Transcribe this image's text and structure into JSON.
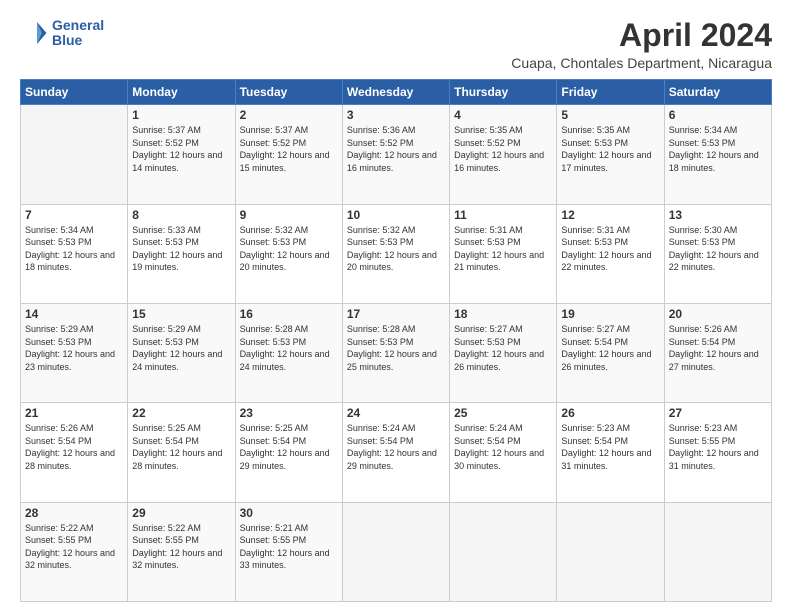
{
  "header": {
    "logo_line1": "General",
    "logo_line2": "Blue",
    "month": "April 2024",
    "location": "Cuapa, Chontales Department, Nicaragua"
  },
  "days_of_week": [
    "Sunday",
    "Monday",
    "Tuesday",
    "Wednesday",
    "Thursday",
    "Friday",
    "Saturday"
  ],
  "weeks": [
    [
      {
        "day": "",
        "sunrise": "",
        "sunset": "",
        "daylight": ""
      },
      {
        "day": "1",
        "sunrise": "5:37 AM",
        "sunset": "5:52 PM",
        "daylight": "12 hours and 14 minutes."
      },
      {
        "day": "2",
        "sunrise": "5:37 AM",
        "sunset": "5:52 PM",
        "daylight": "12 hours and 15 minutes."
      },
      {
        "day": "3",
        "sunrise": "5:36 AM",
        "sunset": "5:52 PM",
        "daylight": "12 hours and 16 minutes."
      },
      {
        "day": "4",
        "sunrise": "5:35 AM",
        "sunset": "5:52 PM",
        "daylight": "12 hours and 16 minutes."
      },
      {
        "day": "5",
        "sunrise": "5:35 AM",
        "sunset": "5:53 PM",
        "daylight": "12 hours and 17 minutes."
      },
      {
        "day": "6",
        "sunrise": "5:34 AM",
        "sunset": "5:53 PM",
        "daylight": "12 hours and 18 minutes."
      }
    ],
    [
      {
        "day": "7",
        "sunrise": "5:34 AM",
        "sunset": "5:53 PM",
        "daylight": "12 hours and 18 minutes."
      },
      {
        "day": "8",
        "sunrise": "5:33 AM",
        "sunset": "5:53 PM",
        "daylight": "12 hours and 19 minutes."
      },
      {
        "day": "9",
        "sunrise": "5:32 AM",
        "sunset": "5:53 PM",
        "daylight": "12 hours and 20 minutes."
      },
      {
        "day": "10",
        "sunrise": "5:32 AM",
        "sunset": "5:53 PM",
        "daylight": "12 hours and 20 minutes."
      },
      {
        "day": "11",
        "sunrise": "5:31 AM",
        "sunset": "5:53 PM",
        "daylight": "12 hours and 21 minutes."
      },
      {
        "day": "12",
        "sunrise": "5:31 AM",
        "sunset": "5:53 PM",
        "daylight": "12 hours and 22 minutes."
      },
      {
        "day": "13",
        "sunrise": "5:30 AM",
        "sunset": "5:53 PM",
        "daylight": "12 hours and 22 minutes."
      }
    ],
    [
      {
        "day": "14",
        "sunrise": "5:29 AM",
        "sunset": "5:53 PM",
        "daylight": "12 hours and 23 minutes."
      },
      {
        "day": "15",
        "sunrise": "5:29 AM",
        "sunset": "5:53 PM",
        "daylight": "12 hours and 24 minutes."
      },
      {
        "day": "16",
        "sunrise": "5:28 AM",
        "sunset": "5:53 PM",
        "daylight": "12 hours and 24 minutes."
      },
      {
        "day": "17",
        "sunrise": "5:28 AM",
        "sunset": "5:53 PM",
        "daylight": "12 hours and 25 minutes."
      },
      {
        "day": "18",
        "sunrise": "5:27 AM",
        "sunset": "5:53 PM",
        "daylight": "12 hours and 26 minutes."
      },
      {
        "day": "19",
        "sunrise": "5:27 AM",
        "sunset": "5:54 PM",
        "daylight": "12 hours and 26 minutes."
      },
      {
        "day": "20",
        "sunrise": "5:26 AM",
        "sunset": "5:54 PM",
        "daylight": "12 hours and 27 minutes."
      }
    ],
    [
      {
        "day": "21",
        "sunrise": "5:26 AM",
        "sunset": "5:54 PM",
        "daylight": "12 hours and 28 minutes."
      },
      {
        "day": "22",
        "sunrise": "5:25 AM",
        "sunset": "5:54 PM",
        "daylight": "12 hours and 28 minutes."
      },
      {
        "day": "23",
        "sunrise": "5:25 AM",
        "sunset": "5:54 PM",
        "daylight": "12 hours and 29 minutes."
      },
      {
        "day": "24",
        "sunrise": "5:24 AM",
        "sunset": "5:54 PM",
        "daylight": "12 hours and 29 minutes."
      },
      {
        "day": "25",
        "sunrise": "5:24 AM",
        "sunset": "5:54 PM",
        "daylight": "12 hours and 30 minutes."
      },
      {
        "day": "26",
        "sunrise": "5:23 AM",
        "sunset": "5:54 PM",
        "daylight": "12 hours and 31 minutes."
      },
      {
        "day": "27",
        "sunrise": "5:23 AM",
        "sunset": "5:55 PM",
        "daylight": "12 hours and 31 minutes."
      }
    ],
    [
      {
        "day": "28",
        "sunrise": "5:22 AM",
        "sunset": "5:55 PM",
        "daylight": "12 hours and 32 minutes."
      },
      {
        "day": "29",
        "sunrise": "5:22 AM",
        "sunset": "5:55 PM",
        "daylight": "12 hours and 32 minutes."
      },
      {
        "day": "30",
        "sunrise": "5:21 AM",
        "sunset": "5:55 PM",
        "daylight": "12 hours and 33 minutes."
      },
      {
        "day": "",
        "sunrise": "",
        "sunset": "",
        "daylight": ""
      },
      {
        "day": "",
        "sunrise": "",
        "sunset": "",
        "daylight": ""
      },
      {
        "day": "",
        "sunrise": "",
        "sunset": "",
        "daylight": ""
      },
      {
        "day": "",
        "sunrise": "",
        "sunset": "",
        "daylight": ""
      }
    ]
  ],
  "labels": {
    "sunrise_prefix": "Sunrise: ",
    "sunset_prefix": "Sunset: ",
    "daylight_prefix": "Daylight: "
  }
}
